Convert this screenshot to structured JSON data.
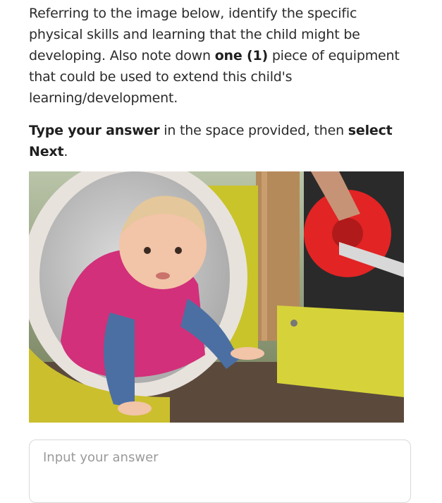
{
  "question": {
    "text_1": "Referring to the image below, identify the specific physical skills and learning that the child might be developing. Also note down ",
    "bold_1": "one (1)",
    "text_2": " piece of equipment that could be used to extend this child's learning/development."
  },
  "instruction": {
    "bold_1": "Type your answer",
    "text_1": " in the space provided, then ",
    "bold_2": "select Next",
    "text_2": "."
  },
  "answer": {
    "placeholder": "Input your answer",
    "value": ""
  },
  "colors": {
    "text": "#2b2b2b",
    "placeholder": "#9a9a9a",
    "border": "#d9d9d9"
  }
}
